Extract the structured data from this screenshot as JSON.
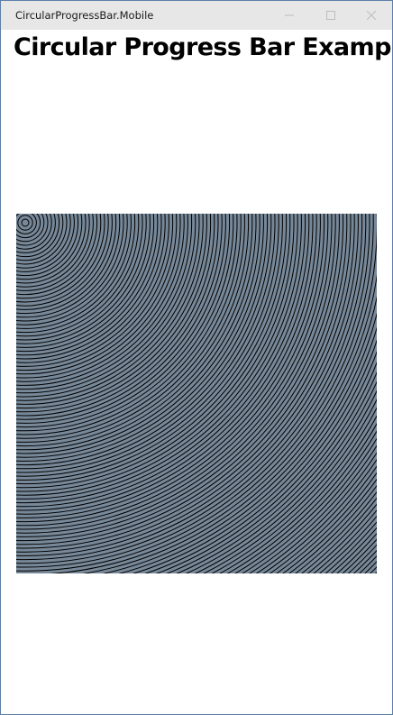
{
  "window": {
    "title": "CircularProgressBar.Mobile",
    "icons": {
      "minimize": "minimize-icon",
      "maximize": "maximize-icon",
      "close": "close-icon"
    }
  },
  "page": {
    "heading": "Circular Progress Bar Example"
  },
  "progress": {
    "fill_color": "#778899",
    "ring_color": "#000000",
    "ring_origin": "top-left"
  }
}
